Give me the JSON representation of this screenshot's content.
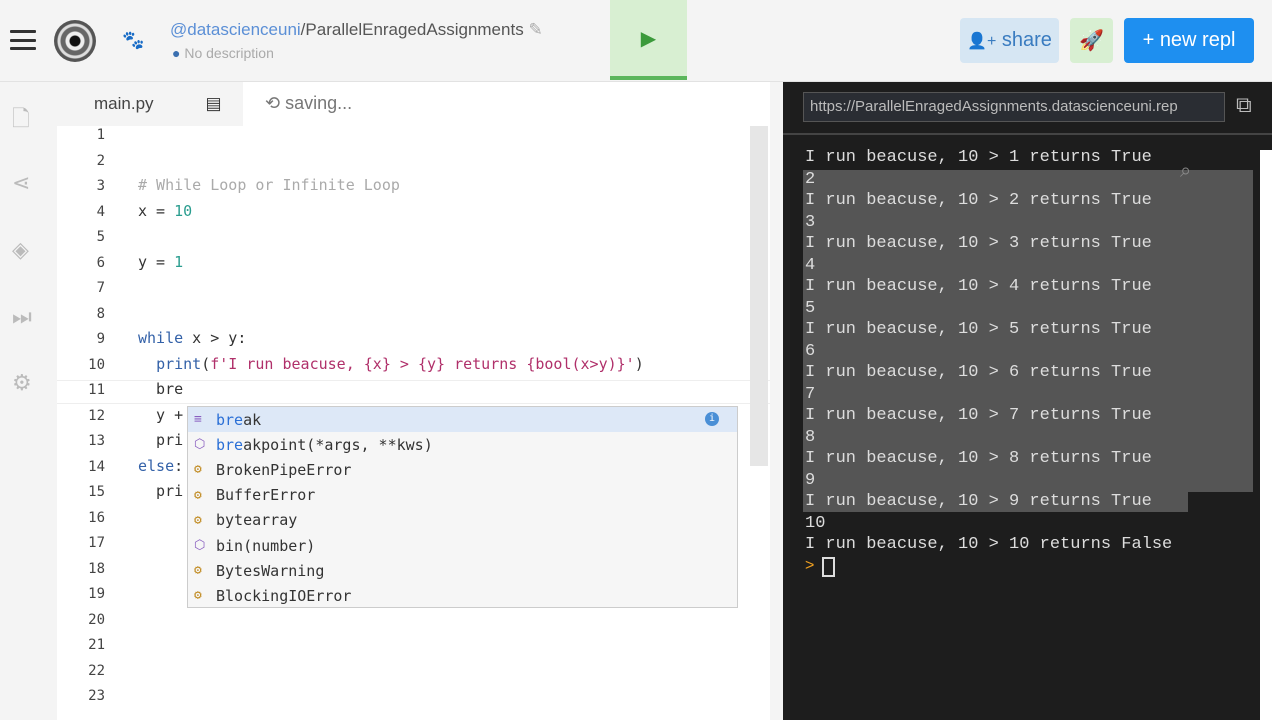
{
  "header": {
    "user": "@datascienceuni",
    "separator": "/",
    "repl_name": "ParallelEnragedAssignments",
    "description": "No description",
    "share_label": "share",
    "new_repl_label": "new repl"
  },
  "editor": {
    "tab": "main.py",
    "status": "saving...",
    "lines": [
      {
        "n": "1",
        "html": ""
      },
      {
        "n": "2",
        "html": ""
      },
      {
        "n": "3",
        "html": "<span class='cm'># While Loop or Infinite Loop</span>"
      },
      {
        "n": "4",
        "html": "x = <span class='num'>10</span>"
      },
      {
        "n": "5",
        "html": ""
      },
      {
        "n": "6",
        "html": "y = <span class='num'>1</span>"
      },
      {
        "n": "7",
        "html": ""
      },
      {
        "n": "8",
        "html": ""
      },
      {
        "n": "9",
        "html": "<span class='kw'>while</span> x &gt; y:"
      },
      {
        "n": "10",
        "html": "  <span class='kw'>print</span>(<span class='str'>f'I run beacuse, {x} &gt; {y} returns {bool(x&gt;y)}'</span>)"
      },
      {
        "n": "11",
        "html": "  bre"
      },
      {
        "n": "12",
        "html": "  y +"
      },
      {
        "n": "13",
        "html": "  pri"
      },
      {
        "n": "14",
        "html": "<span class='kw'>else</span>:"
      },
      {
        "n": "15",
        "html": "  pri"
      },
      {
        "n": "16",
        "html": ""
      },
      {
        "n": "17",
        "html": ""
      },
      {
        "n": "18",
        "html": ""
      },
      {
        "n": "19",
        "html": ""
      },
      {
        "n": "20",
        "html": ""
      },
      {
        "n": "21",
        "html": ""
      },
      {
        "n": "22",
        "html": ""
      },
      {
        "n": "23",
        "html": ""
      }
    ],
    "autocomplete": [
      {
        "match": "bre",
        "rest": "ak",
        "kind": "keyword"
      },
      {
        "match": "bre",
        "rest": "akpoint(*args, **kws)",
        "kind": "method"
      },
      {
        "match": "Bre",
        "rest": "BrokenPipeError",
        "kind": "class"
      },
      {
        "match": "",
        "rest": "BufferError",
        "kind": "class"
      },
      {
        "match": "",
        "rest": "bytearray",
        "kind": "class"
      },
      {
        "match": "",
        "rest": "bin(number)",
        "kind": "method"
      },
      {
        "match": "",
        "rest": "BytesWarning",
        "kind": "class"
      },
      {
        "match": "",
        "rest": "BlockingIOError",
        "kind": "class"
      }
    ]
  },
  "console": {
    "url": "https://ParallelEnragedAssignments.datascienceuni.rep",
    "lines": [
      "I run beacuse, 10 > 1 returns True",
      "2",
      "I run beacuse, 10 > 2 returns True",
      "3",
      "I run beacuse, 10 > 3 returns True",
      "4",
      "I run beacuse, 10 > 4 returns True",
      "5",
      "I run beacuse, 10 > 5 returns True",
      "6",
      "I run beacuse, 10 > 6 returns True",
      "7",
      "I run beacuse, 10 > 7 returns True",
      "8",
      "I run beacuse, 10 > 8 returns True",
      "9",
      "I run beacuse, 10 > 9 returns True",
      "10",
      "I run beacuse, 10 > 10 returns False"
    ],
    "prompt": ">"
  }
}
